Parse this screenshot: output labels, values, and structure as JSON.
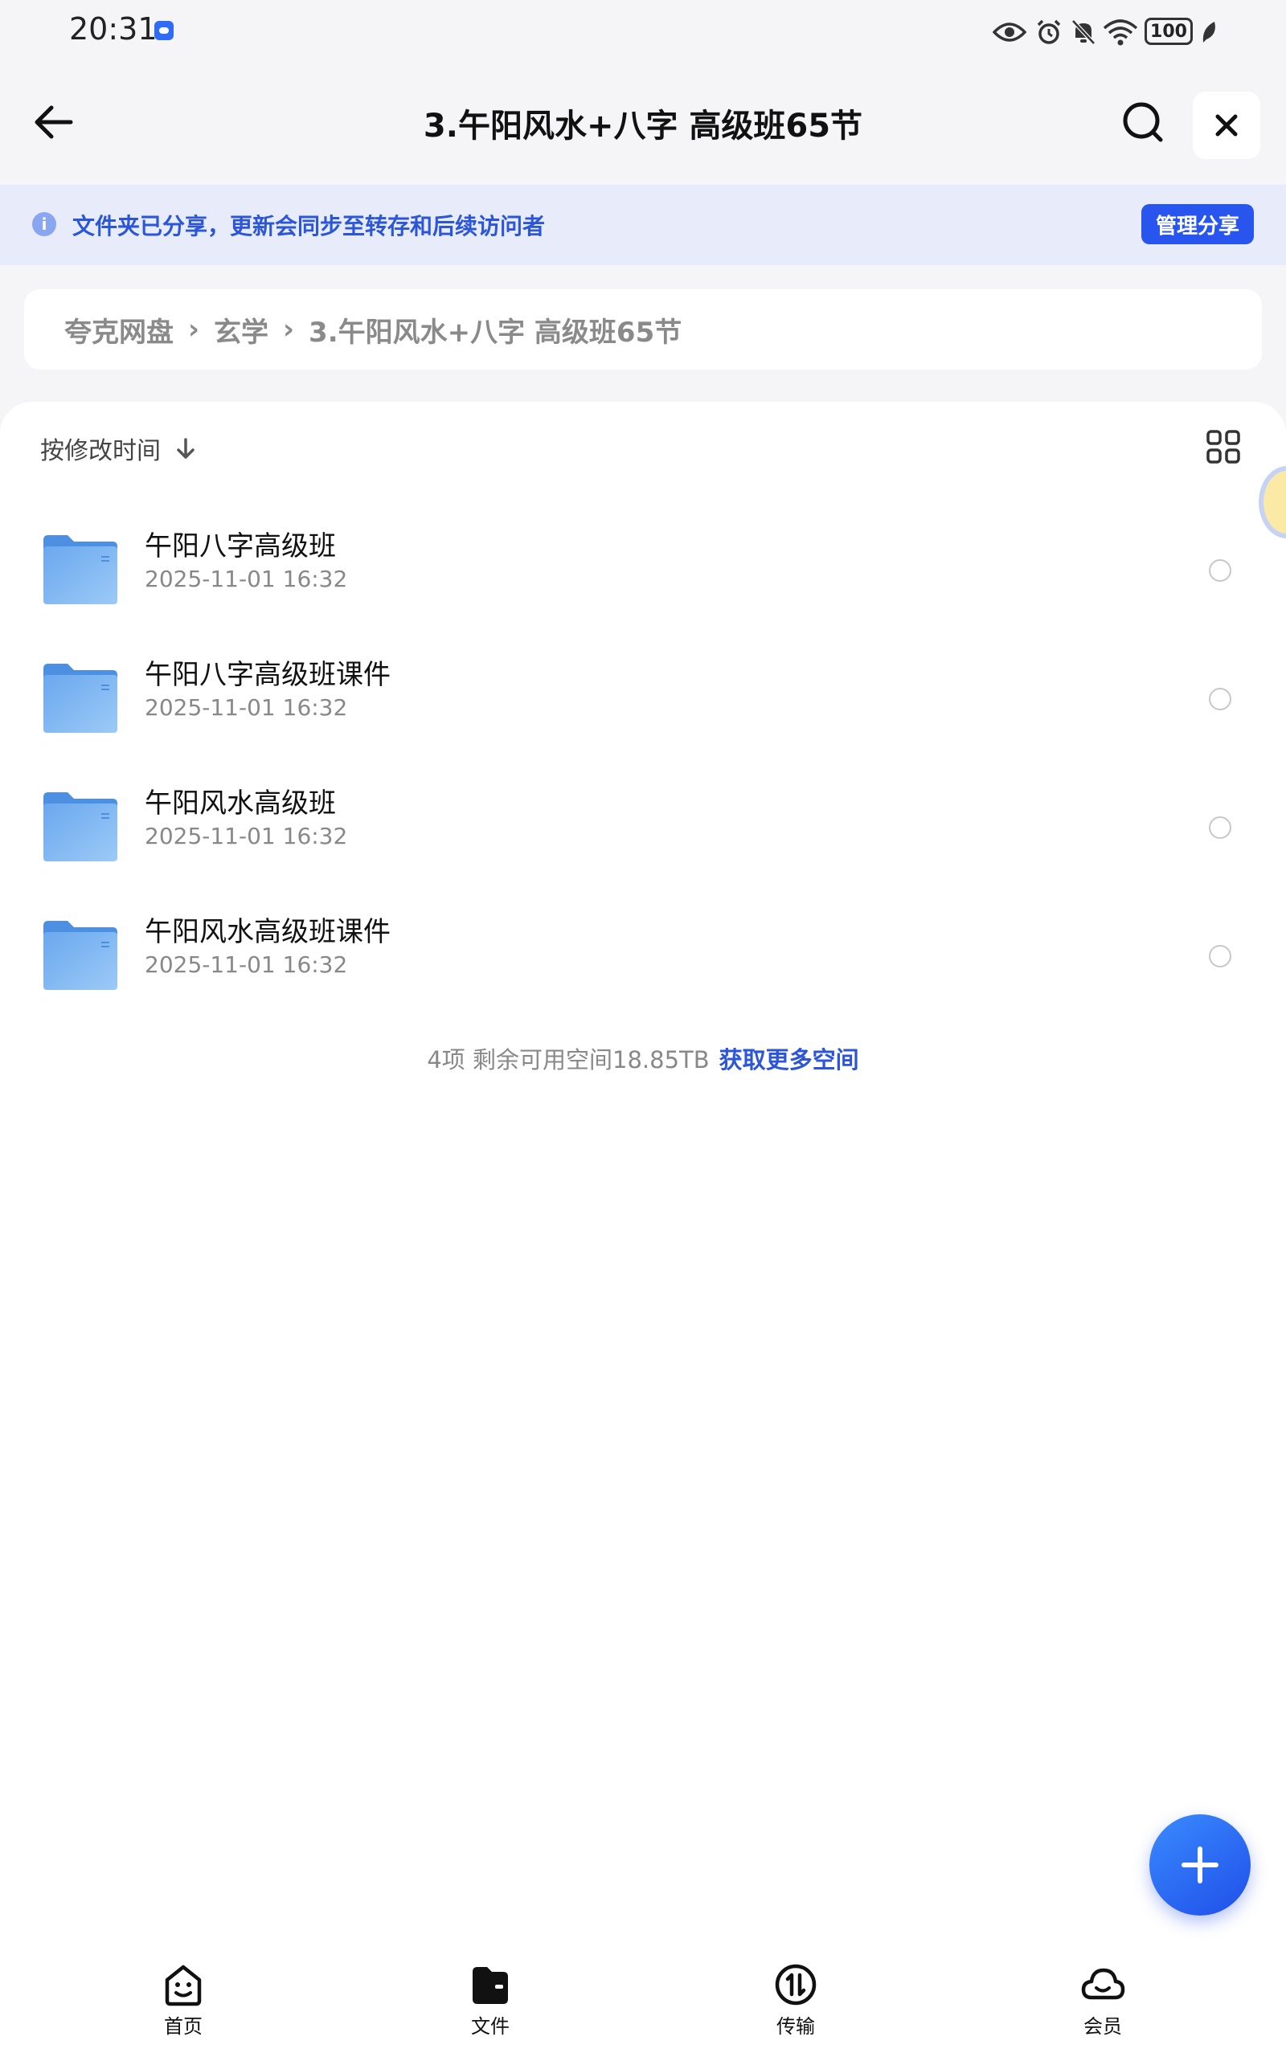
{
  "status_bar": {
    "time": "20:31",
    "battery": "100",
    "icons": [
      "app-notification-icon",
      "eye-icon",
      "alarm-icon",
      "mute-icon",
      "wifi-icon",
      "battery-icon",
      "leaf-icon"
    ]
  },
  "header": {
    "title": "3.午阳风水+八字 高级班65节",
    "icons": [
      "back-arrow-icon",
      "search-icon",
      "close-icon"
    ]
  },
  "share_banner": {
    "text": "文件夹已分享，更新会同步至转存和后续访问者",
    "button": "管理分享",
    "info_icon_glyph": "i"
  },
  "breadcrumb": {
    "items": [
      "夸克网盘",
      "玄学",
      "3.午阳风水+八字 高级班65节"
    ],
    "separator": "›"
  },
  "sort": {
    "label": "按修改时间"
  },
  "files": [
    {
      "name": "午阳八字高级班",
      "date": "2025-11-01 16:32"
    },
    {
      "name": "午阳八字高级班课件",
      "date": "2025-11-01 16:32"
    },
    {
      "name": "午阳风水高级班",
      "date": "2025-11-01 16:32"
    },
    {
      "name": "午阳风水高级班课件",
      "date": "2025-11-01 16:32"
    }
  ],
  "footer": {
    "info": "4项 剩余可用空间18.85TB",
    "link": "获取更多空间"
  },
  "bottom_nav": [
    {
      "label": "首页",
      "icon": "home-smile-icon"
    },
    {
      "label": "文件",
      "icon": "files-icon"
    },
    {
      "label": "传输",
      "icon": "transfer-icon"
    },
    {
      "label": "会员",
      "icon": "cloud-icon"
    }
  ],
  "colors": {
    "accent": "#2855ee",
    "banner_bg": "#e8ecfa",
    "folder": "#6aa8ee"
  }
}
